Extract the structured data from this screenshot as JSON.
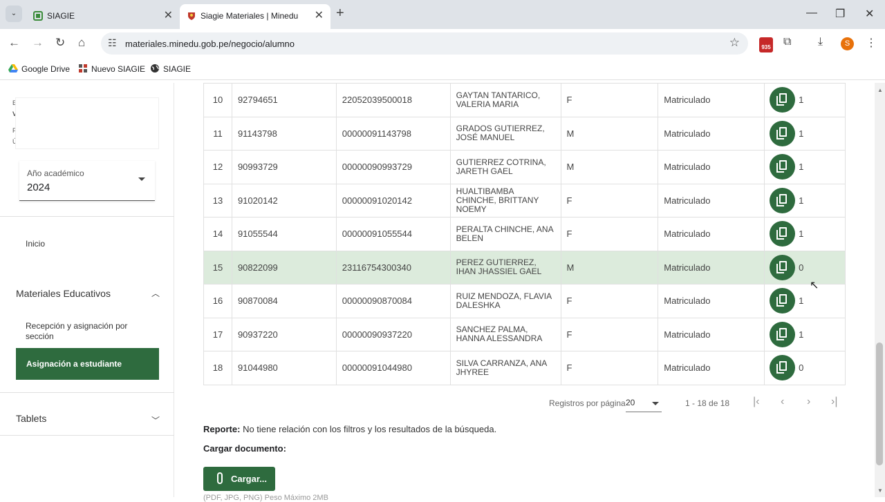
{
  "browser": {
    "tabs": [
      {
        "title": "SIAGIE",
        "active": false
      },
      {
        "title": "Siagie Materiales | Minedu",
        "active": true
      }
    ],
    "url": "materiales.minedu.gob.pe/negocio/alumno",
    "extension_badge": "935",
    "profile_initial": "S",
    "bookmarks": [
      "Google Drive",
      "Nuevo SIAGIE",
      "SIAGIE"
    ]
  },
  "sidebar": {
    "year_label": "Año académico",
    "year_value": "2024",
    "inicio": "Inicio",
    "materiales_group": "Materiales Educativos",
    "recepcion": "Recepción y asignación por sección",
    "asignacion_active": "Asignación a estudiante",
    "tablets_group": "Tablets"
  },
  "table": {
    "rows": [
      {
        "n": "10",
        "dni": "92794651",
        "codigo": "22052039500018",
        "nombre": "GAYTAN TANTARICO, VALERIA MARIA",
        "sexo": "F",
        "estado": "Matriculado",
        "count": "1"
      },
      {
        "n": "11",
        "dni": "91143798",
        "codigo": "00000091143798",
        "nombre": "GRADOS GUTIERREZ, JOSÉ MANUEL",
        "sexo": "M",
        "estado": "Matriculado",
        "count": "1"
      },
      {
        "n": "12",
        "dni": "90993729",
        "codigo": "00000090993729",
        "nombre": "GUTIERREZ COTRINA, JARETH GAEL",
        "sexo": "M",
        "estado": "Matriculado",
        "count": "1"
      },
      {
        "n": "13",
        "dni": "91020142",
        "codigo": "00000091020142",
        "nombre": "HUALTIBAMBA CHINCHE, BRITTANY NOEMY",
        "sexo": "F",
        "estado": "Matriculado",
        "count": "1"
      },
      {
        "n": "14",
        "dni": "91055544",
        "codigo": "00000091055544",
        "nombre": "PERALTA CHINCHE, ANA BELEN",
        "sexo": "F",
        "estado": "Matriculado",
        "count": "1"
      },
      {
        "n": "15",
        "dni": "90822099",
        "codigo": "23116754300340",
        "nombre": "PEREZ GUTIERREZ, IHAN JHASSIEL GAEL",
        "sexo": "M",
        "estado": "Matriculado",
        "count": "0"
      },
      {
        "n": "16",
        "dni": "90870084",
        "codigo": "00000090870084",
        "nombre": "RUIZ MENDOZA, FLAVIA DALESHKA",
        "sexo": "F",
        "estado": "Matriculado",
        "count": "1"
      },
      {
        "n": "17",
        "dni": "90937220",
        "codigo": "00000090937220",
        "nombre": "SANCHEZ PALMA, HANNA ALESSANDRA",
        "sexo": "F",
        "estado": "Matriculado",
        "count": "1"
      },
      {
        "n": "18",
        "dni": "91044980",
        "codigo": "00000091044980",
        "nombre": "SILVA CARRANZA, ANA JHYREE",
        "sexo": "F",
        "estado": "Matriculado",
        "count": "0"
      }
    ]
  },
  "pagination": {
    "label": "Registros por página",
    "per_page": "20",
    "range": "1 - 18 de 18"
  },
  "report": {
    "label": "Reporte:",
    "text": "No tiene relación con los filtros y los resultados de la búsqueda."
  },
  "upload": {
    "title": "Cargar documento:",
    "button": "Cargar...",
    "hint": "(PDF, JPG, PNG) Peso Máximo 2MB"
  },
  "colors": {
    "accent": "#2e6b3e",
    "highlight_row": "#dcebdc"
  }
}
